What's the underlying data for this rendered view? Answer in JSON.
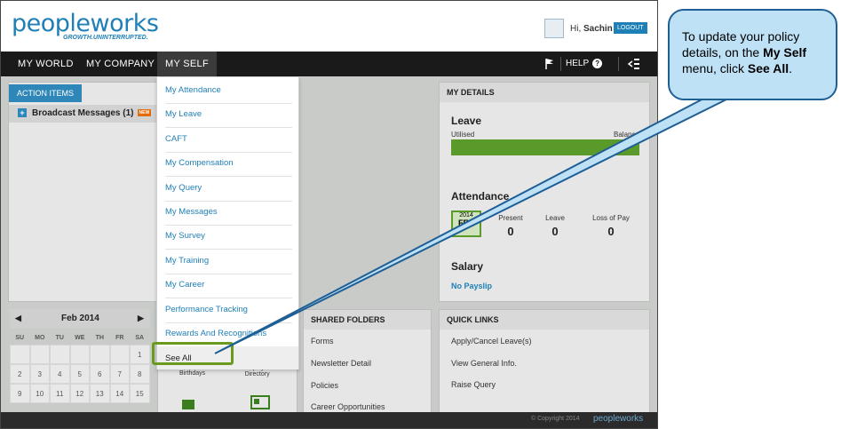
{
  "header": {
    "logo_main": "peopleworks",
    "tagline": "GROWTH.UNINTERRUPTED.",
    "greeting_prefix": "Hi, ",
    "user_name": "Sachin",
    "logout_label": "LOGOUT"
  },
  "nav": {
    "items": [
      "MY WORLD",
      "MY COMPANY",
      "MY SELF"
    ],
    "help_label": "HELP"
  },
  "action_items": {
    "tab_label": "ACTION ITEMS",
    "broadcast_label": "Broadcast Messages (1)",
    "new_badge": "NEW"
  },
  "calendar": {
    "month": "Feb 2014",
    "days_of_week": [
      "SU",
      "MO",
      "TU",
      "WE",
      "TH",
      "FR",
      "SA"
    ],
    "rows": [
      [
        "",
        "",
        "",
        "",
        "",
        "",
        "1"
      ],
      [
        "2",
        "3",
        "4",
        "5",
        "6",
        "7",
        "8"
      ],
      [
        "9",
        "10",
        "11",
        "12",
        "13",
        "14",
        "15"
      ]
    ]
  },
  "dropdown": {
    "items": [
      "My Attendance",
      "My Leave",
      "CAFT",
      "My Compensation",
      "My Query",
      "My Messages",
      "My Survey",
      "My Training",
      "My Career",
      "Performance Tracking",
      "Rewards And Recognitions"
    ],
    "see_all": "See All"
  },
  "middle_bottom": {
    "birthdays": "Birthdays",
    "directory_line1": "Employee",
    "directory_line2": "Directory"
  },
  "shared_folders": {
    "title": "SHARED FOLDERS",
    "items": [
      "Forms",
      "Newsletter Detail",
      "Policies",
      "Career Opportunities"
    ]
  },
  "my_details": {
    "title": "MY DETAILS",
    "leave_title": "Leave",
    "utilised": "Utilised",
    "balance": "Balance",
    "attendance_title": "Attendance",
    "att_year": "2014",
    "att_month": "FEB",
    "present_label": "Present",
    "present_value": "0",
    "leave_label": "Leave",
    "leave_value": "0",
    "lop_label": "Loss of Pay",
    "lop_value": "0",
    "salary_title": "Salary",
    "payslip": "No Payslip"
  },
  "quick_links": {
    "title": "QUICK LINKS",
    "items": [
      "Apply/Cancel Leave(s)",
      "View General Info.",
      "Raise Query"
    ]
  },
  "footer": {
    "copyright": "© Copyright 2014",
    "brand": "peopleworks"
  },
  "callout": {
    "part1": "To update your policy details, on the ",
    "bold1": "My Self",
    "part2": " menu, click ",
    "bold2": "See All",
    "part3": "."
  },
  "colors": {
    "brand_blue": "#1f7fb7",
    "brand_green": "#8dc63f",
    "highlight_green": "#6a9a1e",
    "callout_fill": "#bfe1f6",
    "callout_border": "#1f5f95"
  }
}
